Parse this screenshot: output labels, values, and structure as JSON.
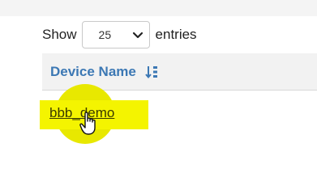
{
  "length_menu": {
    "prefix": "Show",
    "selected": "25",
    "suffix": "entries"
  },
  "table": {
    "columns": [
      "Device Name"
    ],
    "sort_icon": "sort-alpha-down-icon",
    "rows": [
      {
        "device_name": "bbb_demo"
      }
    ]
  },
  "colors": {
    "header_text": "#3c78b4",
    "highlight": "#f4f400"
  }
}
